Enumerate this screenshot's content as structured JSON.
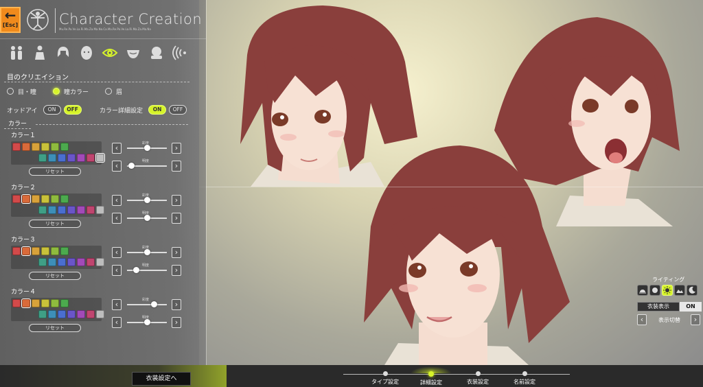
{
  "header": {
    "title": "Character Creation",
    "esc_label": "[Esc]",
    "subtitle": "Mu.Re.Pa.Ve.La.Ri.Ma.Za.Ma.Na.Ca.Ma.Re.Pa.Ve.La.Ri.Ma.Za.Ma.Na"
  },
  "categories": [
    {
      "icon": "body-type-icon"
    },
    {
      "icon": "body-icon"
    },
    {
      "icon": "hair-icon"
    },
    {
      "icon": "face-icon"
    },
    {
      "icon": "eye-icon",
      "active": true
    },
    {
      "icon": "mouth-icon"
    },
    {
      "icon": "makeup-icon"
    },
    {
      "icon": "voice-icon"
    }
  ],
  "section": {
    "title": "目のクリエイション",
    "radios": [
      {
        "label": "目・瞳",
        "selected": false
      },
      {
        "label": "瞳カラー",
        "selected": true
      },
      {
        "label": "眉",
        "selected": false
      }
    ]
  },
  "toggles": {
    "odd_eye": {
      "label": "オッドアイ",
      "on": "ON",
      "off": "OFF",
      "value": "OFF"
    },
    "detail": {
      "label": "カラー詳細設定",
      "on": "ON",
      "off": "OFF",
      "value": "ON"
    }
  },
  "color_section_label": "カラー",
  "color_groups": [
    {
      "label": "カラー１",
      "reset": "リセット",
      "selected_index": 12,
      "saturation_label": "彩度",
      "brightness_label": "明度",
      "saturation": 0.5,
      "brightness": 0.05
    },
    {
      "label": "カラー２",
      "reset": "リセット",
      "selected_index": 1,
      "saturation_label": "彩度",
      "brightness_label": "明度",
      "saturation": 0.5,
      "brightness": 0.5
    },
    {
      "label": "カラー３",
      "reset": "リセット",
      "selected_index": 1,
      "saturation_label": "彩度",
      "brightness_label": "明度",
      "saturation": 0.5,
      "brightness": 0.18
    },
    {
      "label": "カラー４",
      "reset": "リセット",
      "selected_index": 1,
      "saturation_label": "彩度",
      "brightness_label": "明度",
      "saturation": 0.72,
      "brightness": 0.5
    }
  ],
  "swatch_colors_top": [
    "#d24a4a",
    "#d96a3a",
    "#d8a23a",
    "#c9c23a",
    "#8fbb3e",
    "#4caa4e"
  ],
  "swatch_colors_bottom": [
    "#3f9f86",
    "#3d8fb8",
    "#4a6ed0",
    "#6a55c8",
    "#a24ab8",
    "#c0456f",
    "#bdbdbd"
  ],
  "footer": {
    "to_costume": "衣装設定へ",
    "steps": [
      {
        "label": "タイプ設定",
        "active": false
      },
      {
        "label": "詳細設定",
        "active": true
      },
      {
        "label": "衣装設定",
        "active": false
      },
      {
        "label": "名前設定",
        "active": false
      }
    ]
  },
  "lighting": {
    "title": "ライティング",
    "presets": [
      "sunrise-icon",
      "sun-dim-icon",
      "sun-icon",
      "sunset-icon",
      "moon-icon"
    ],
    "active_index": 2,
    "costume_label": "衣装表示",
    "costume_value": "ON",
    "switch_label": "表示切替"
  },
  "colors": {
    "accent": "#d6f32a",
    "esc": "#f08a1c"
  }
}
